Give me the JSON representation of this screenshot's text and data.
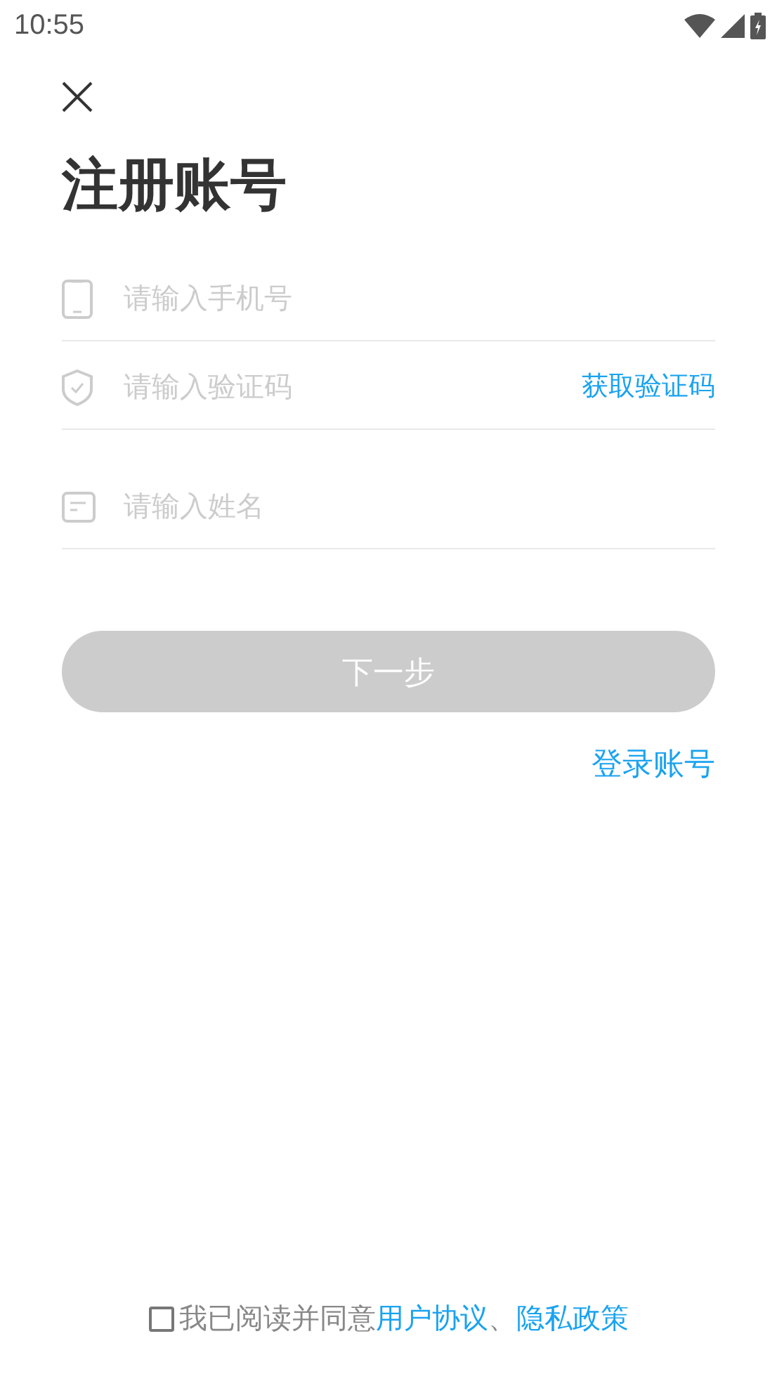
{
  "status_bar": {
    "time": "10:55"
  },
  "title": "注册账号",
  "fields": [
    {
      "kind": "phone",
      "placeholder": "请输入手机号"
    },
    {
      "kind": "code",
      "placeholder": "请输入验证码",
      "action": "获取验证码"
    },
    {
      "kind": "name",
      "placeholder": "请输入姓名"
    }
  ],
  "next_button": {
    "label": "下一步",
    "disabled": true
  },
  "login_link": "登录账号",
  "agreement": {
    "checked": false,
    "text": "我已阅读并同意",
    "links": [
      "用户协议",
      "隐私政策"
    ],
    "separator": "、"
  }
}
